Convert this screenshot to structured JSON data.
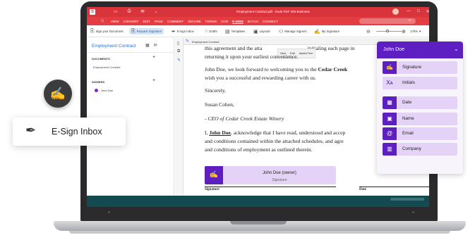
{
  "app": {
    "window_title": "Employment Contract.pdf   -   Soda PDF 360 Business",
    "logo_letter": "S",
    "title_icons": [
      "save-icon",
      "print-icon",
      "email-icon",
      "dropdown-icon"
    ],
    "window_controls": [
      "—",
      "□",
      "✕"
    ]
  },
  "menu": {
    "items": [
      "VIEW",
      "CONVERT",
      "EDIT",
      "PAGE",
      "COMMENT",
      "SECURE",
      "FORMS",
      "OCR",
      "E-SIGN",
      "BATCH",
      "CONNECT"
    ],
    "active": "E-SIGN"
  },
  "toolbar": {
    "sign_your_document": "Sign your Document",
    "request_signature": "Request Signature",
    "e_sign_inbox": "E-sign Inbox",
    "drafts": "Drafts",
    "templates": "Templates",
    "layouts": "Layouts",
    "manage_signers": "Manage Signers",
    "my_signature": "My Signature",
    "zoom": "175%"
  },
  "left_panel": {
    "title": "Employment Contract",
    "documents_heading": "DOCUMENTS",
    "document_item": "Employment Contract",
    "signers_heading": "SIGNERS",
    "signer_name": "John Doe"
  },
  "doc_tab": {
    "name": "Employment Contract"
  },
  "mini_toolbar": [
    "View",
    "Edit",
    "Added Text"
  ],
  "document": {
    "line1a": "this agreement and the atta",
    "line1b": " initialing each page in",
    "line2": "returning it upon your earliest convenience.",
    "line3a": "John Doe, we look forward to welcoming you to the ",
    "line3b": "Cedar Creek",
    "line4": "wish you a successful and rewarding career with us.",
    "sincerely": "Sincerely,",
    "signer_name": "Susan Cohen,",
    "ceo_line": "- CEO of Cedar Creek Estate Winery",
    "ack1a": "I, ",
    "ack1b": "John Doe",
    "ack1c": ", acknowledge that I have read, understood and accep",
    "ack2": "and conditions contained within the attached schedules, and agre",
    "ack3": "and conditions of employment as outlined therein.",
    "sig_field_name": "John Doe (owner)",
    "sig_field_type": "Signature",
    "signature_label": "Signature",
    "date_label": "Date"
  },
  "fields_panel": {
    "signer": "John Doe",
    "items": [
      {
        "label": "Signature",
        "icon": "signature-icon"
      },
      {
        "label": "Initials",
        "icon": "initials-icon"
      },
      {
        "label": "Date",
        "icon": "calendar-icon"
      },
      {
        "label": "Name",
        "icon": "id-card-icon"
      },
      {
        "label": "Email",
        "icon": "at-icon"
      },
      {
        "label": "Company",
        "icon": "building-icon"
      }
    ]
  },
  "widgets": {
    "esign_inbox_label": "E-Sign Inbox"
  },
  "colors": {
    "brand_red": "#d9343b",
    "accent_purple": "#5d1ec2",
    "field_lavender": "#e4d3f7",
    "link_blue": "#2a6fd6"
  }
}
